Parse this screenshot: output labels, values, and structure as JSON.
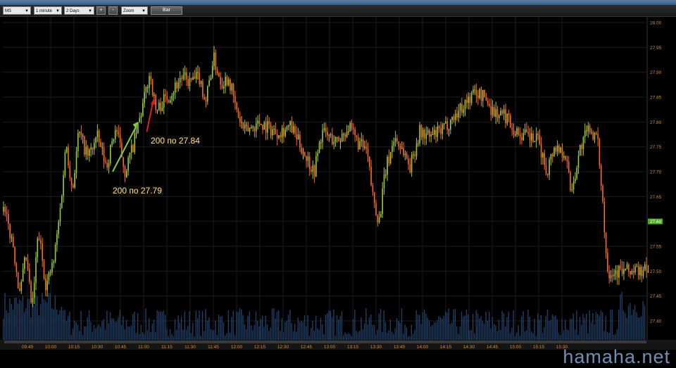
{
  "toolbar": {
    "symbol": "MS",
    "interval": "1 minute",
    "period": "2 Days",
    "plus_label": "+",
    "minus_label": "-",
    "zoom_label": "Zoom",
    "bar_label": "Bar"
  },
  "annotations": {
    "buy_low": "200 по 27.79",
    "buy_high": "200 по 27.84"
  },
  "watermark": "hamaha.net",
  "colors": {
    "up": "#9acd32",
    "down": "#ff6a1a",
    "neutral": "#e8c050",
    "volume": "#1f3f66",
    "grid": "#1c1c1c",
    "current_price_bg": "#4caf1a",
    "arrow_buy": "#7fcf3f",
    "arrow_sell": "#e02020"
  },
  "chart_data": {
    "type": "candlestick",
    "symbol": "MS",
    "interval": "1 minute",
    "x_ticks": [
      "09:45",
      "10:00",
      "10:15",
      "10:30",
      "10:45",
      "11:00",
      "11:15",
      "11:30",
      "11:45",
      "12:00",
      "12:15",
      "12:30",
      "12:45",
      "13:00",
      "13:15",
      "13:30",
      "13:45",
      "14:00",
      "14:15",
      "14:30",
      "14:45",
      "15:00",
      "15:15",
      "15:30"
    ],
    "y_ticks": [
      "28.00",
      "27.95",
      "27.90",
      "27.85",
      "27.80",
      "27.75",
      "27.70",
      "27.65",
      "27.60",
      "27.55",
      "27.50",
      "27.45",
      "27.40"
    ],
    "ylim": [
      27.38,
      28.01
    ],
    "current_price": "27.60",
    "price_path": [
      {
        "t": "09:30",
        "p": 27.62
      },
      {
        "t": "09:36",
        "p": 27.55
      },
      {
        "t": "09:40",
        "p": 27.45
      },
      {
        "t": "09:44",
        "p": 27.53
      },
      {
        "t": "09:48",
        "p": 27.42
      },
      {
        "t": "09:52",
        "p": 27.58
      },
      {
        "t": "09:57",
        "p": 27.47
      },
      {
        "t": "10:02",
        "p": 27.52
      },
      {
        "t": "10:06",
        "p": 27.62
      },
      {
        "t": "10:10",
        "p": 27.76
      },
      {
        "t": "10:14",
        "p": 27.66
      },
      {
        "t": "10:18",
        "p": 27.78
      },
      {
        "t": "10:24",
        "p": 27.73
      },
      {
        "t": "10:30",
        "p": 27.77
      },
      {
        "t": "10:36",
        "p": 27.71
      },
      {
        "t": "10:42",
        "p": 27.79
      },
      {
        "t": "10:48",
        "p": 27.7
      },
      {
        "t": "10:54",
        "p": 27.76
      },
      {
        "t": "11:00",
        "p": 27.84
      },
      {
        "t": "11:04",
        "p": 27.9
      },
      {
        "t": "11:08",
        "p": 27.82
      },
      {
        "t": "11:12",
        "p": 27.84
      },
      {
        "t": "11:18",
        "p": 27.86
      },
      {
        "t": "11:24",
        "p": 27.89
      },
      {
        "t": "11:30",
        "p": 27.88
      },
      {
        "t": "11:36",
        "p": 27.89
      },
      {
        "t": "11:40",
        "p": 27.84
      },
      {
        "t": "11:45",
        "p": 27.93
      },
      {
        "t": "11:50",
        "p": 27.88
      },
      {
        "t": "11:55",
        "p": 27.89
      },
      {
        "t": "12:00",
        "p": 27.82
      },
      {
        "t": "12:05",
        "p": 27.78
      },
      {
        "t": "12:15",
        "p": 27.8
      },
      {
        "t": "12:25",
        "p": 27.78
      },
      {
        "t": "12:35",
        "p": 27.79
      },
      {
        "t": "12:45",
        "p": 27.73
      },
      {
        "t": "12:50",
        "p": 27.7
      },
      {
        "t": "12:55",
        "p": 27.78
      },
      {
        "t": "13:05",
        "p": 27.76
      },
      {
        "t": "13:12",
        "p": 27.79
      },
      {
        "t": "13:18",
        "p": 27.76
      },
      {
        "t": "13:24",
        "p": 27.74
      },
      {
        "t": "13:28",
        "p": 27.65
      },
      {
        "t": "13:32",
        "p": 27.6
      },
      {
        "t": "13:36",
        "p": 27.7
      },
      {
        "t": "13:42",
        "p": 27.77
      },
      {
        "t": "13:48",
        "p": 27.74
      },
      {
        "t": "13:52",
        "p": 27.71
      },
      {
        "t": "13:58",
        "p": 27.78
      },
      {
        "t": "14:05",
        "p": 27.77
      },
      {
        "t": "14:12",
        "p": 27.78
      },
      {
        "t": "14:20",
        "p": 27.81
      },
      {
        "t": "14:28",
        "p": 27.84
      },
      {
        "t": "14:34",
        "p": 27.86
      },
      {
        "t": "14:40",
        "p": 27.85
      },
      {
        "t": "14:46",
        "p": 27.82
      },
      {
        "t": "14:55",
        "p": 27.81
      },
      {
        "t": "15:00",
        "p": 27.78
      },
      {
        "t": "15:08",
        "p": 27.77
      },
      {
        "t": "15:15",
        "p": 27.76
      },
      {
        "t": "15:20",
        "p": 27.7
      },
      {
        "t": "15:25",
        "p": 27.75
      },
      {
        "t": "15:32",
        "p": 27.74
      },
      {
        "t": "15:36",
        "p": 27.66
      },
      {
        "t": "15:42",
        "p": 27.75
      },
      {
        "t": "15:48",
        "p": 27.79
      },
      {
        "t": "15:53",
        "p": 27.76
      },
      {
        "t": "15:56",
        "p": 27.66
      },
      {
        "t": "15:58",
        "p": 27.55
      },
      {
        "t": "16:00",
        "p": 27.5
      }
    ]
  }
}
